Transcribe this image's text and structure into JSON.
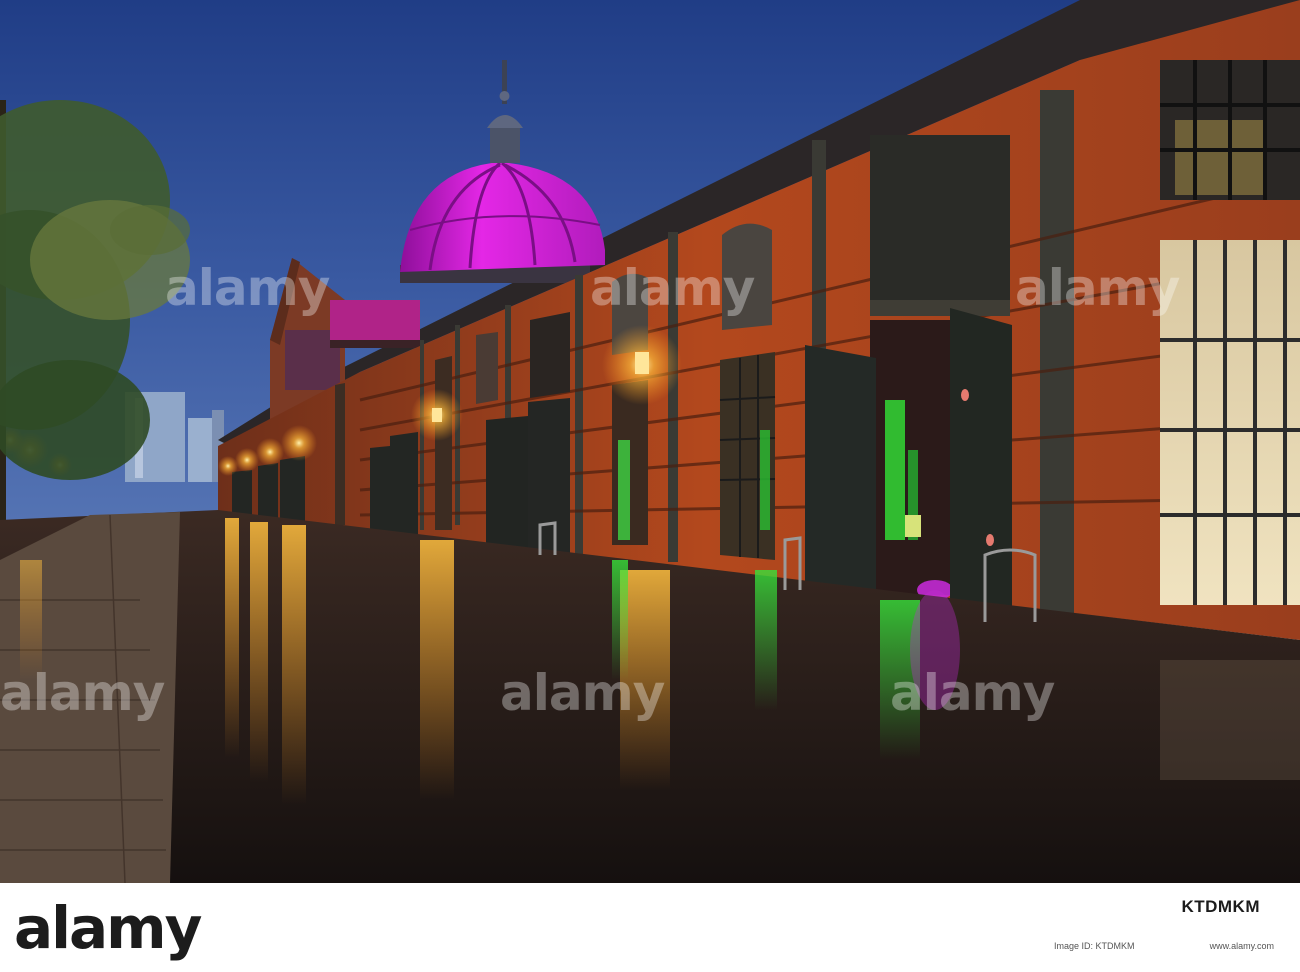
{
  "watermark": {
    "text": "alamy"
  },
  "footer": {
    "logo": "alamy",
    "image_id": "KTDMKM",
    "id_small": "Image ID: KTDMKM",
    "url": "www.alamy.com"
  },
  "colors": {
    "sky": "#2f4a8c",
    "dome": "#d21ad8",
    "brick": "#a8461d",
    "lamp": "#ffb838",
    "door_glow": "#2fd12f"
  }
}
